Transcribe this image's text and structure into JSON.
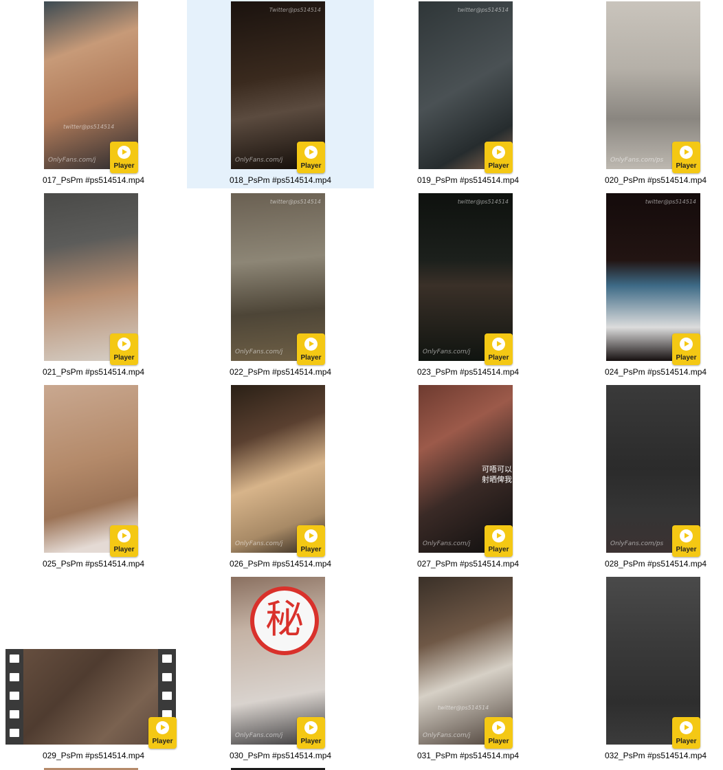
{
  "badge_label": "Player",
  "selected_index": 1,
  "files": [
    {
      "name": "017_PsPm #ps514514.mp4",
      "wm_top": "",
      "wm_mid": "twitter@ps514514",
      "wm_bottom": "OnlyFans.com/j",
      "icon": "video-thumbnail-icon"
    },
    {
      "name": "018_PsPm #ps514514.mp4",
      "wm_top": "Twitter@ps514514",
      "wm_bottom": "OnlyFans.com/j",
      "icon": "video-thumbnail-icon"
    },
    {
      "name": "019_PsPm #ps514514.mp4",
      "wm_top": "twitter@ps514514",
      "wm_bottom": "",
      "icon": "video-thumbnail-icon"
    },
    {
      "name": "020_PsPm #ps514514.mp4",
      "wm_top": "",
      "wm_bottom": "OnlyFans.com/ps",
      "icon": "video-thumbnail-icon"
    },
    {
      "name": "021_PsPm #ps514514.mp4",
      "wm_top": "",
      "wm_bottom": "",
      "icon": "video-thumbnail-icon"
    },
    {
      "name": "022_PsPm #ps514514.mp4",
      "wm_top": "twitter@ps514514",
      "wm_bottom": "OnlyFans.com/j",
      "icon": "video-thumbnail-icon"
    },
    {
      "name": "023_PsPm #ps514514.mp4",
      "wm_top": "twitter@ps514514",
      "wm_bottom": "OnlyFans.com/j",
      "icon": "video-thumbnail-icon"
    },
    {
      "name": "024_PsPm #ps514514.mp4",
      "wm_top": "twitter@ps514514",
      "wm_bottom": "",
      "icon": "video-thumbnail-icon"
    },
    {
      "name": "025_PsPm #ps514514.mp4",
      "wm_top": "",
      "wm_bottom": "",
      "icon": "video-thumbnail-icon"
    },
    {
      "name": "026_PsPm #ps514514.mp4",
      "wm_top": "",
      "wm_bottom": "OnlyFans.com/j",
      "icon": "video-thumbnail-icon"
    },
    {
      "name": "027_PsPm #ps514514.mp4",
      "wm_top": "",
      "wm_bottom": "OnlyFans.com/j",
      "cn_text": [
        "可唔可以",
        "射晒俾我"
      ],
      "icon": "video-thumbnail-icon"
    },
    {
      "name": "028_PsPm #ps514514.mp4",
      "wm_top": "",
      "wm_bottom": "OnlyFans.com/ps",
      "icon": "video-thumbnail-icon"
    },
    {
      "name": "029_PsPm #ps514514.mp4",
      "wm_top": "",
      "wm_bottom": "",
      "icon": "film-strip-icon",
      "wide": true
    },
    {
      "name": "030_PsPm #ps514514.mp4",
      "wm_top": "",
      "wm_bottom": "OnlyFans.com/j",
      "secret_char": "秘",
      "icon": "video-thumbnail-icon"
    },
    {
      "name": "031_PsPm #ps514514.mp4",
      "wm_top": "",
      "wm_mid": "twitter@ps514514",
      "wm_bottom": "OnlyFans.com/j",
      "icon": "video-thumbnail-icon"
    },
    {
      "name": "032_PsPm #ps514514.mp4",
      "wm_top": "",
      "wm_bottom": "",
      "icon": "video-thumbnail-icon"
    }
  ],
  "colors": {
    "selection": "#e5f1fb",
    "badge": "#f4c814"
  }
}
